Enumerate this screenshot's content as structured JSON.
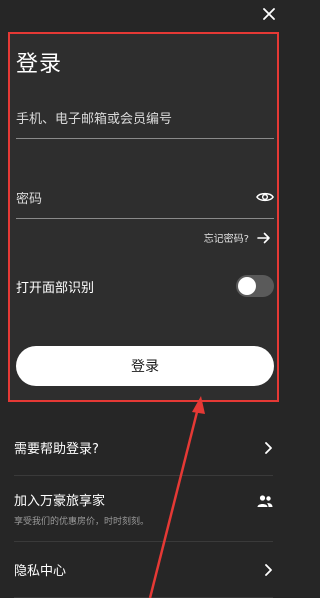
{
  "dialog": {
    "close_label": "×"
  },
  "login": {
    "title": "登录",
    "account_placeholder": "手机、电子邮箱或会员编号",
    "password_placeholder": "密码",
    "forgot_label": "忘记密码?",
    "face_id_label": "打开面部识别",
    "face_id_enabled": false,
    "submit_label": "登录"
  },
  "menu": {
    "help_label": "需要帮助登录?",
    "join_label": "加入万豪旅享家",
    "join_subtitle": "享受我们的优惠房价，时时刻刻。",
    "privacy_label": "隐私中心"
  },
  "colors": {
    "background": "#262626",
    "card": "#2e2e2e",
    "highlight": "#e53935"
  }
}
